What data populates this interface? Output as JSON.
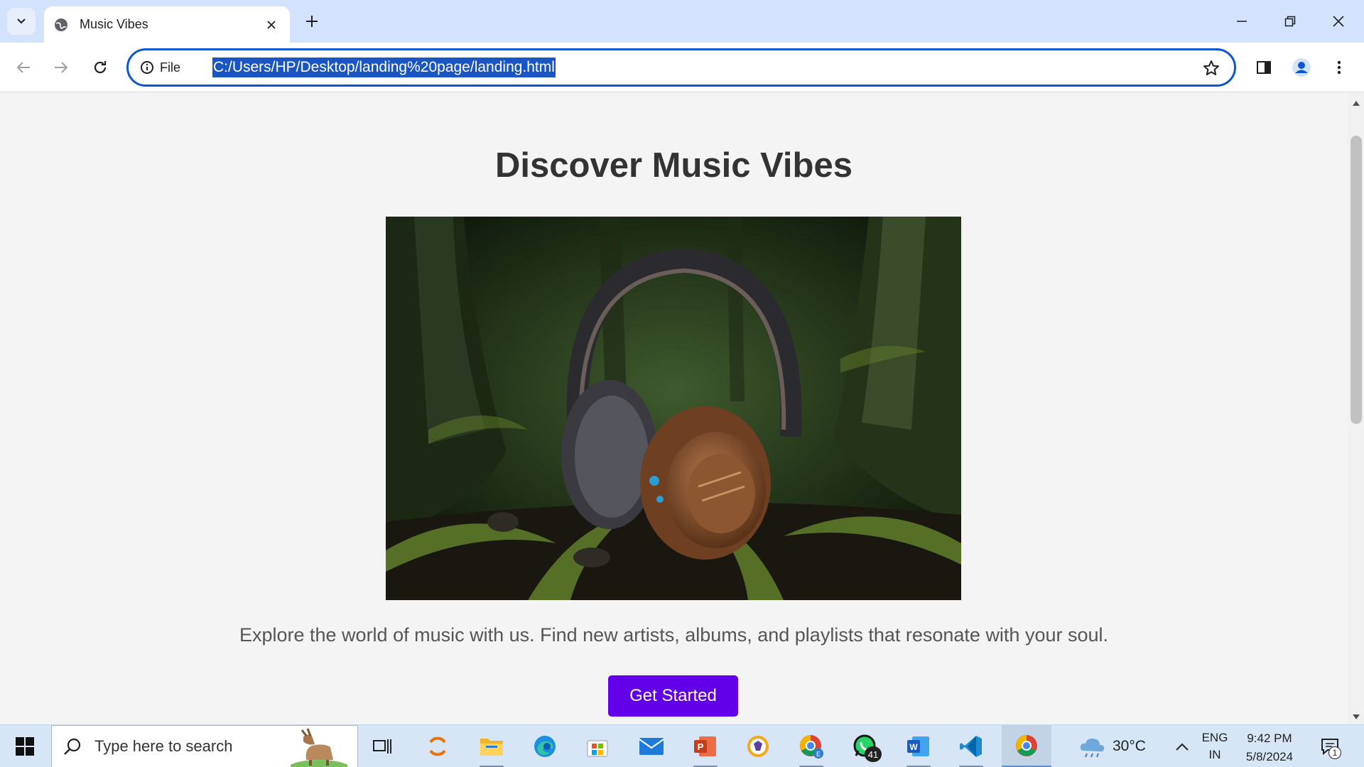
{
  "browser": {
    "tab_title": "Music Vibes",
    "omnibox_scheme_label": "File",
    "url": "C:/Users/HP/Desktop/landing%20page/landing.html"
  },
  "page": {
    "heading": "Discover Music Vibes",
    "tagline": "Explore the world of music with us. Find new artists, albums, and playlists that resonate with your soul.",
    "cta_label": "Get Started",
    "cta_color": "#6200ea",
    "hero_image": "headphones-in-forest"
  },
  "taskbar": {
    "search_placeholder": "Type here to search",
    "apps": [
      "task-view",
      "app-loader",
      "file-explorer",
      "edge",
      "microsoft-store",
      "mail",
      "powerpoint",
      "brave",
      "chrome-profile",
      "whatsapp",
      "word",
      "vs-code",
      "chrome"
    ],
    "whatsapp_badge": "41",
    "weather_temp": "30°C",
    "lang_line1": "ENG",
    "lang_line2": "IN",
    "time": "9:42 PM",
    "date": "5/8/2024",
    "notification_count": "1"
  },
  "colors": {
    "tabstrip": "#d3e3fd",
    "omnibox_border": "#0b57d0",
    "url_highlight": "#1a55c4",
    "taskbar": "#d7e6f6"
  }
}
